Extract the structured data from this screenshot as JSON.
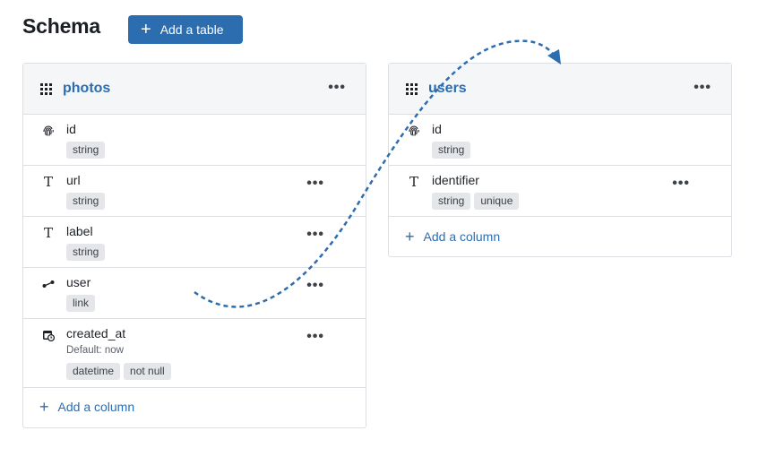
{
  "page": {
    "title": "Schema",
    "add_table_label": "Add a table"
  },
  "tables": [
    {
      "name": "photos",
      "add_column_label": "Add a column",
      "columns": [
        {
          "name": "id",
          "icon": "fingerprint-icon",
          "tags": [
            "string"
          ]
        },
        {
          "name": "url",
          "icon": "text-type-icon",
          "tags": [
            "string"
          ]
        },
        {
          "name": "label",
          "icon": "text-type-icon",
          "tags": [
            "string"
          ]
        },
        {
          "name": "user",
          "icon": "link-icon",
          "tags": [
            "link"
          ]
        },
        {
          "name": "created_at",
          "icon": "calendar-clock-icon",
          "default": "Default: now",
          "tags": [
            "datetime",
            "not null"
          ]
        }
      ]
    },
    {
      "name": "users",
      "add_column_label": "Add a column",
      "columns": [
        {
          "name": "id",
          "icon": "fingerprint-icon",
          "tags": [
            "string"
          ]
        },
        {
          "name": "identifier",
          "icon": "text-type-icon",
          "tags": [
            "string",
            "unique"
          ]
        }
      ]
    }
  ],
  "colors": {
    "accent": "#2c6db0",
    "header_bg": "#f5f6f7",
    "tag_bg": "#e4e6e9",
    "border": "#dcdfe3"
  }
}
